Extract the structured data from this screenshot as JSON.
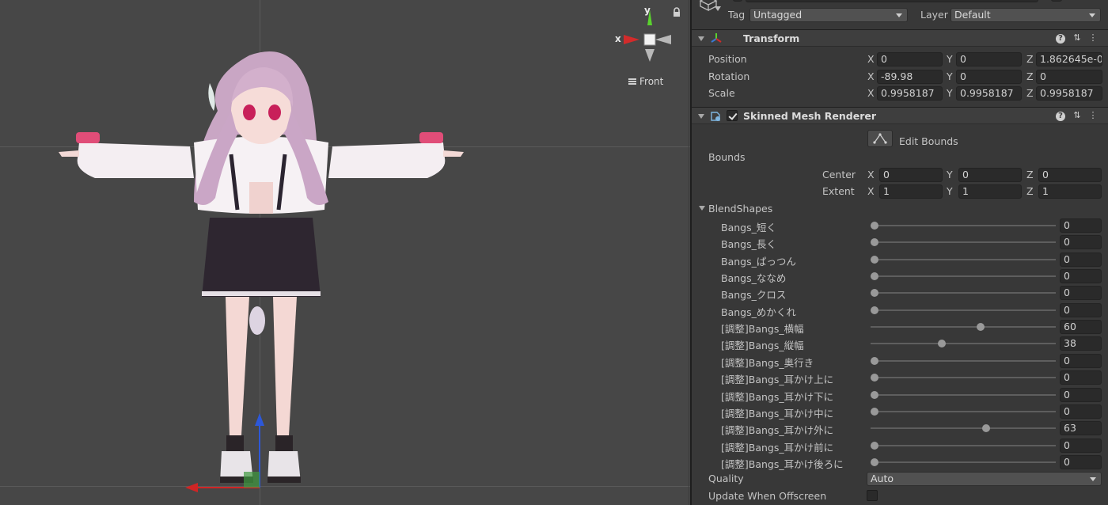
{
  "scene": {
    "view_label": "Front",
    "gizmo": {
      "y_label": "y",
      "x_label": "x",
      "y_color": "#5ad22e",
      "x_color": "#d22b2b"
    },
    "icons": [
      "lock-icon",
      "hamburger-icon"
    ]
  },
  "inspector": {
    "tag_label": "Tag",
    "tag_value": "Untagged",
    "layer_label": "Layer",
    "layer_value": "Default",
    "transform": {
      "title": "Transform",
      "rows": [
        {
          "label": "Position",
          "x": "0",
          "y": "0",
          "z": "1.862645e-0"
        },
        {
          "label": "Rotation",
          "x": "-89.98",
          "y": "0",
          "z": "0"
        },
        {
          "label": "Scale",
          "x": "0.9958187",
          "y": "0.9958187",
          "z": "0.9958187"
        }
      ]
    },
    "axes": {
      "x": "X",
      "y": "Y",
      "z": "Z"
    },
    "renderer": {
      "title": "Skinned Mesh Renderer",
      "enabled": true,
      "edit_bounds_label": "Edit Bounds",
      "bounds_label": "Bounds",
      "center": {
        "label": "Center",
        "x": "0",
        "y": "0",
        "z": "0"
      },
      "extent": {
        "label": "Extent",
        "x": "1",
        "y": "1",
        "z": "1"
      },
      "blendshapes_label": "BlendShapes",
      "blendshapes": [
        {
          "name": "Bangs_短く",
          "value": 0
        },
        {
          "name": "Bangs_長く",
          "value": 0
        },
        {
          "name": "Bangs_ぱっつん",
          "value": 0
        },
        {
          "name": "Bangs_ななめ",
          "value": 0
        },
        {
          "name": "Bangs_クロス",
          "value": 0
        },
        {
          "name": "Bangs_めかくれ",
          "value": 0
        },
        {
          "name": "[調整]Bangs_横幅",
          "value": 60
        },
        {
          "name": "[調整]Bangs_縦幅",
          "value": 38
        },
        {
          "name": "[調整]Bangs_奥行き",
          "value": 0
        },
        {
          "name": "[調整]Bangs_耳かけ上に",
          "value": 0
        },
        {
          "name": "[調整]Bangs_耳かけ下に",
          "value": 0
        },
        {
          "name": "[調整]Bangs_耳かけ中に",
          "value": 0
        },
        {
          "name": "[調整]Bangs_耳かけ外に",
          "value": 63
        },
        {
          "name": "[調整]Bangs_耳かけ前に",
          "value": 0
        },
        {
          "name": "[調整]Bangs_耳かけ後ろに",
          "value": 0
        }
      ],
      "quality_label": "Quality",
      "quality_value": "Auto",
      "update_offscreen_label": "Update When Offscreen",
      "update_offscreen": false
    }
  }
}
